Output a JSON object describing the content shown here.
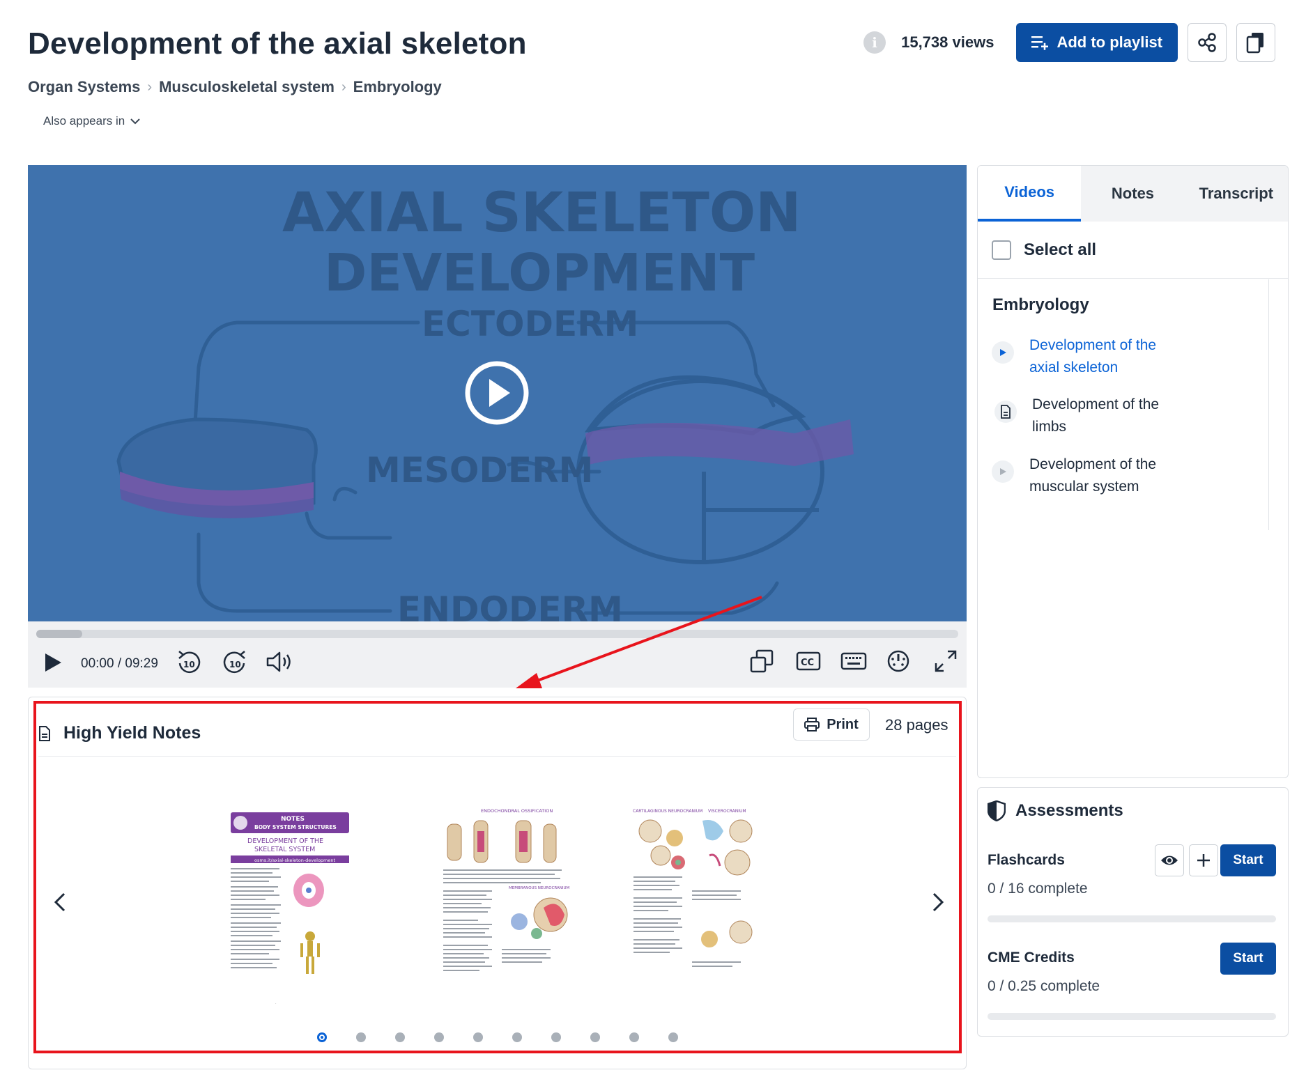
{
  "header": {
    "title": "Development of the axial skeleton",
    "views": "15,738 views",
    "add_to_playlist": "Add to playlist",
    "also_appears_in": "Also appears in"
  },
  "breadcrumb": [
    "Organ Systems",
    "Musculoskeletal system",
    "Embryology"
  ],
  "video": {
    "art_text": {
      "line1": "AXIAL  SKELETON",
      "line2": "DEVELOPMENT",
      "ectoderm": "ECTODERM",
      "mesoderm": "MESODERM",
      "endoderm": "ENDODERM"
    },
    "time": "00:00 / 09:29",
    "progress_fraction": 0.05
  },
  "notes": {
    "title": "High Yield Notes",
    "print": "Print",
    "pages": "28 pages",
    "dots_count": 10,
    "active_dot": 0,
    "page1": {
      "header1": "NOTES",
      "header2": "BODY SYSTEM STRUCTURES",
      "title1": "DEVELOPMENT OF THE",
      "title2": "SKELETAL SYSTEM",
      "url": "osms.it/axial-skeleton-development"
    },
    "page2": {
      "heading": "ENDOCHONDRAL OSSIFICATION",
      "heading2": "MEMBRANOUS NEUROCRANIUM"
    },
    "page3": {
      "heading": "CARTILAGINOUS NEUROCRANIUM",
      "heading2": "VISCEROCRANIUM"
    }
  },
  "sidebar": {
    "tabs": [
      "Videos",
      "Notes",
      "Transcript"
    ],
    "active_tab": 0,
    "select_all": "Select all",
    "section": "Embryology",
    "items": [
      {
        "label": "Development of the axial skeleton",
        "icon": "play-icon",
        "active": true
      },
      {
        "label": "Development of the limbs",
        "icon": "document-icon",
        "active": false
      },
      {
        "label": "Development of the muscular system",
        "icon": "play-icon",
        "active": false
      }
    ]
  },
  "assessments": {
    "title": "Assessments",
    "flashcards": {
      "label": "Flashcards",
      "progress": "0 / 16 complete",
      "start": "Start"
    },
    "cme": {
      "label": "CME Credits",
      "progress": "0 / 0.25 complete",
      "start": "Start"
    }
  },
  "colors": {
    "primary": "#0b4ea2",
    "link": "#0b63d6",
    "video_bg": "#3f72ad",
    "annotation": "#e8141c"
  }
}
